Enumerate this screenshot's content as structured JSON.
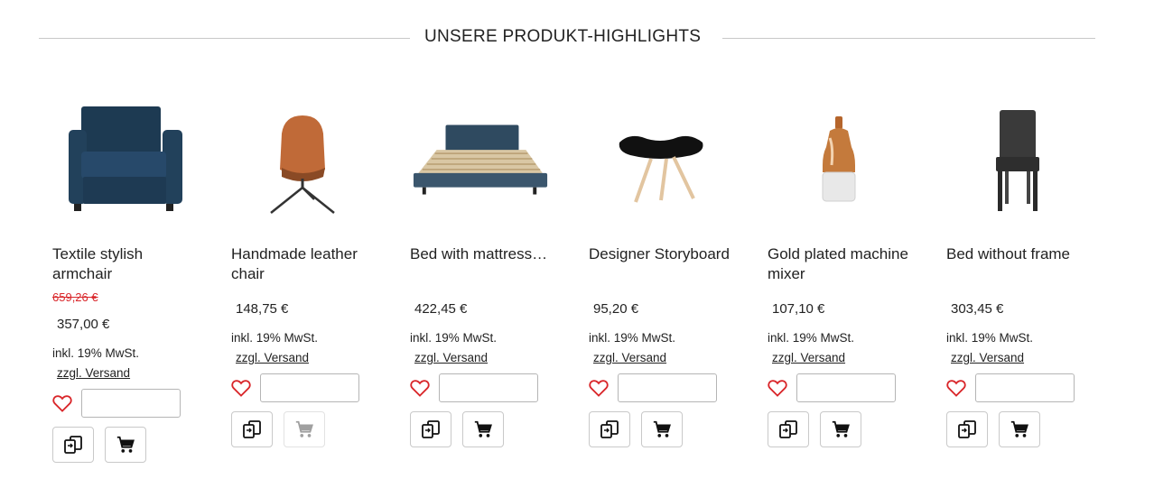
{
  "section": {
    "heading": "UNSERE PRODUKT-HIGHLIGHTS"
  },
  "colors": {
    "heart": "#d9262a",
    "old_price": "#d9262a",
    "cart_icon": "#111111",
    "cart_icon_disabled": "#a0a0a0"
  },
  "products": [
    {
      "title": "Textile stylish armchair",
      "old_price": "659,26 €",
      "price": "357,00 €",
      "tax": "inkl. 19% MwSt.",
      "shipping": "zzgl. Versand",
      "quantity": "",
      "image": "armchair-icon",
      "cart_enabled": true
    },
    {
      "title": "Handmade leather chair",
      "price": "148,75 €",
      "tax": "inkl. 19% MwSt.",
      "shipping": "zzgl. Versand",
      "quantity": "",
      "image": "leather-chair-icon",
      "cart_enabled": false
    },
    {
      "title": "Bed with mattress…",
      "price": "422,45 €",
      "tax": "inkl. 19% MwSt.",
      "shipping": "zzgl. Versand",
      "quantity": "",
      "image": "bed-icon",
      "cart_enabled": true
    },
    {
      "title": "Designer Storyboard",
      "price": "95,20 €",
      "tax": "inkl. 19% MwSt.",
      "shipping": "zzgl. Versand",
      "quantity": "",
      "image": "stool-icon",
      "cart_enabled": true
    },
    {
      "title": "Gold plated machine mixer",
      "price": "107,10 €",
      "tax": "inkl. 19% MwSt.",
      "shipping": "zzgl. Versand",
      "quantity": "",
      "image": "mixer-icon",
      "cart_enabled": true
    },
    {
      "title": "Bed without frame",
      "price": "303,45 €",
      "tax": "inkl. 19% MwSt.",
      "shipping": "zzgl. Versand",
      "quantity": "",
      "image": "dining-chair-icon",
      "cart_enabled": true
    }
  ]
}
